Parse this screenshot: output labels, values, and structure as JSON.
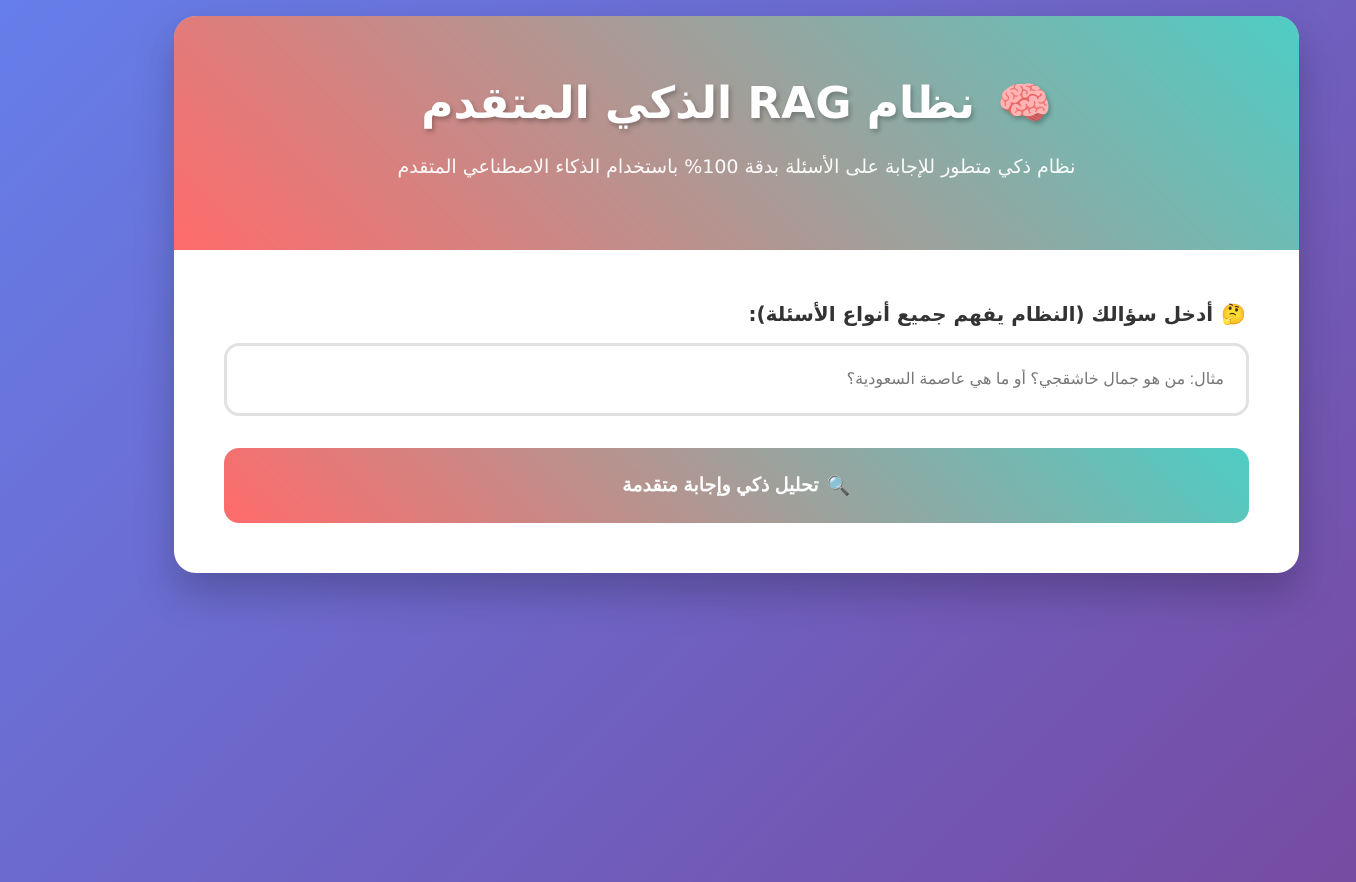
{
  "header": {
    "title": "نظام RAG الذكي المتقدم",
    "title_icon": "🧠",
    "subtitle": "نظام ذكي متطور للإجابة على الأسئلة بدقة 100% باستخدام الذكاء الاصطناعي المتقدم"
  },
  "form": {
    "label_icon": "🤔",
    "label": "أدخل سؤالك (النظام يفهم جميع أنواع الأسئلة):",
    "input_placeholder": "مثال: من هو جمال خاشقجي؟ أو ما هي عاصمة السعودية؟",
    "input_value": "",
    "button_icon": "🔍",
    "button_label": "تحليل ذكي وإجابة متقدمة"
  },
  "colors": {
    "background_start": "#667eea",
    "background_end": "#764ba2",
    "accent_start": "#ff6b6b",
    "accent_end": "#4ecdc4"
  }
}
